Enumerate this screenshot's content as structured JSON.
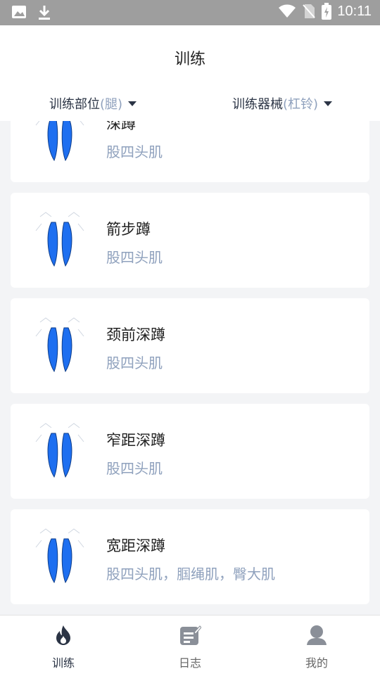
{
  "status_bar": {
    "time": "10:11"
  },
  "header": {
    "title": "训练",
    "filters": [
      {
        "label": "训练部位",
        "value": "(腿)"
      },
      {
        "label": "训练器械",
        "value": "(杠铃)"
      }
    ]
  },
  "exercises": [
    {
      "name": "深蹲",
      "muscles": "股四头肌"
    },
    {
      "name": "箭步蹲",
      "muscles": "股四头肌"
    },
    {
      "name": "颈前深蹲",
      "muscles": "股四头肌"
    },
    {
      "name": "窄距深蹲",
      "muscles": "股四头肌"
    },
    {
      "name": "宽距深蹲",
      "muscles": "股四头肌，腘绳肌，臀大肌"
    }
  ],
  "bottom_nav": [
    {
      "label": "训练",
      "icon": "flame-icon",
      "active": true
    },
    {
      "label": "日志",
      "icon": "notebook-edit-icon",
      "active": false
    },
    {
      "label": "我的",
      "icon": "person-icon",
      "active": false
    }
  ],
  "colors": {
    "accent": "#2b3445",
    "muted": "#8fa1bd",
    "muscle_highlight": "#1e6ff0"
  }
}
